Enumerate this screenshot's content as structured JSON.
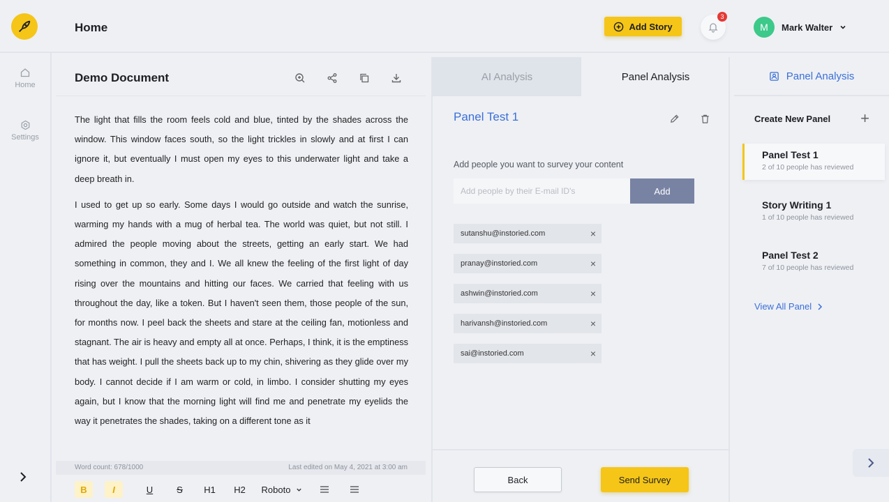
{
  "header": {
    "title": "Home",
    "add_story_label": "Add Story",
    "notification_count": "3",
    "user_initial": "M",
    "user_name": "Mark Walter"
  },
  "sidebar": {
    "items": [
      {
        "label": "Home",
        "icon": "home-icon"
      },
      {
        "label": "Settings",
        "icon": "gear-icon"
      }
    ]
  },
  "document": {
    "title": "Demo Document",
    "paragraphs": [
      "The light that fills the room feels cold and blue, tinted by the shades across the window. This window faces south, so the light trickles in slowly and at first I can ignore it, but eventually I must open my eyes to this underwater light and take a deep breath in.",
      "I used to get up so early. Some days I would go outside and watch the sunrise, warming my hands with a mug of herbal tea. The world was quiet, but not still. I admired the people moving about the streets, getting an early start. We had something in common, they and I. We all knew the feeling of the first light of day rising over the mountains and hitting our faces. We carried that feeling with us throughout the day, like a token. But I haven't seen them, those people of the sun, for months now. I peel back the sheets and stare at the ceiling fan, motionless and stagnant. The air is heavy and empty all at once. Perhaps, I think, it is the emptiness that has weight. I pull the sheets back up to my chin, shivering as they glide over my body. I cannot decide if I am warm or cold, in limbo. I consider shutting my eyes again, but I know that the morning light will find me and penetrate my eyelids the way it penetrates the shades, taking on a different tone as it"
    ],
    "word_count": "Word count: 678/1000",
    "last_edited": "Last edited on May 4, 2021 at 3:00 am",
    "format": {
      "bold": "B",
      "italic": "I",
      "underline": "U",
      "strike": "S",
      "h1": "H1",
      "h2": "H2",
      "font": "Roboto"
    }
  },
  "analysis": {
    "tabs": [
      "AI Analysis",
      "Panel Analysis"
    ],
    "panel_title": "Panel Test 1",
    "add_people_label": "Add people you want to survey your content",
    "email_placeholder": "Add people by their E-mail ID's",
    "add_button": "Add",
    "emails": [
      "sutanshu@instoried.com",
      "pranay@instoried.com",
      "ashwin@instoried.com",
      "harivansh@instoried.com",
      "sai@instoried.com"
    ],
    "back_label": "Back",
    "send_label": "Send Survey"
  },
  "right_panel": {
    "title": "Panel Analysis",
    "create_label": "Create New Panel",
    "panels": [
      {
        "name": "Panel Test 1",
        "status": "2 of 10 people has reviewed"
      },
      {
        "name": "Story Writing 1",
        "status": "1 of 10 people has reviewed"
      },
      {
        "name": "Panel Test 2",
        "status": "7 of 10 people has reviewed"
      }
    ],
    "view_all": "View All Panel"
  },
  "colors": {
    "accent_yellow": "#f5c518",
    "link_blue": "#3b6fd8",
    "add_button_bg": "#7883a4",
    "avatar_green": "#3cc98a",
    "badge_red": "#e53935"
  }
}
